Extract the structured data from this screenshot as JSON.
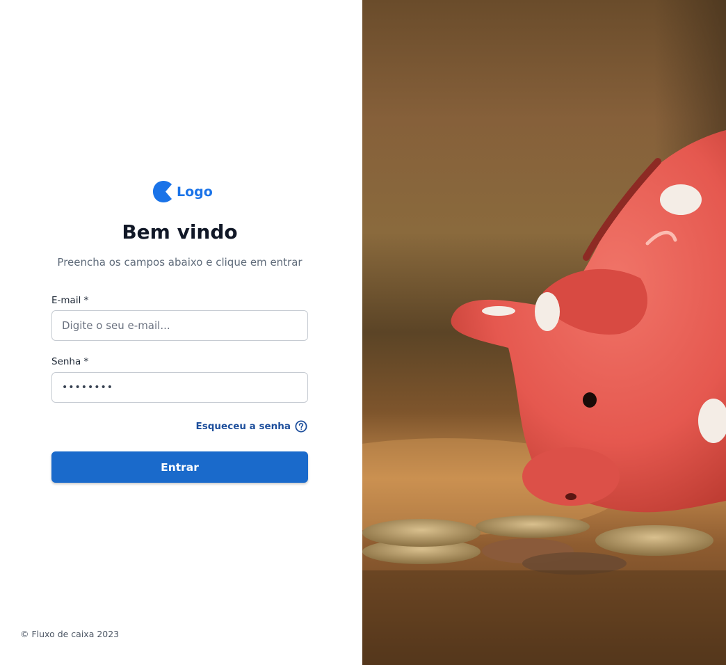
{
  "logo": {
    "text": "Logo",
    "color": "#1a73e8"
  },
  "header": {
    "title": "Bem vindo",
    "subtitle": "Preencha os campos abaixo e clique em entrar"
  },
  "form": {
    "email": {
      "label": "E-mail *",
      "placeholder": "Digite o seu e-mail...",
      "value": ""
    },
    "password": {
      "label": "Senha *",
      "value": "••••••••"
    },
    "forgot_link": "Esqueceu a senha",
    "forgot_icon": "help-circle-icon",
    "submit_label": "Entrar"
  },
  "footer": {
    "text": "© Fluxo de caixa 2023"
  },
  "colors": {
    "primary": "#1a6acb",
    "link": "#1e4f9c",
    "title": "#111827"
  }
}
